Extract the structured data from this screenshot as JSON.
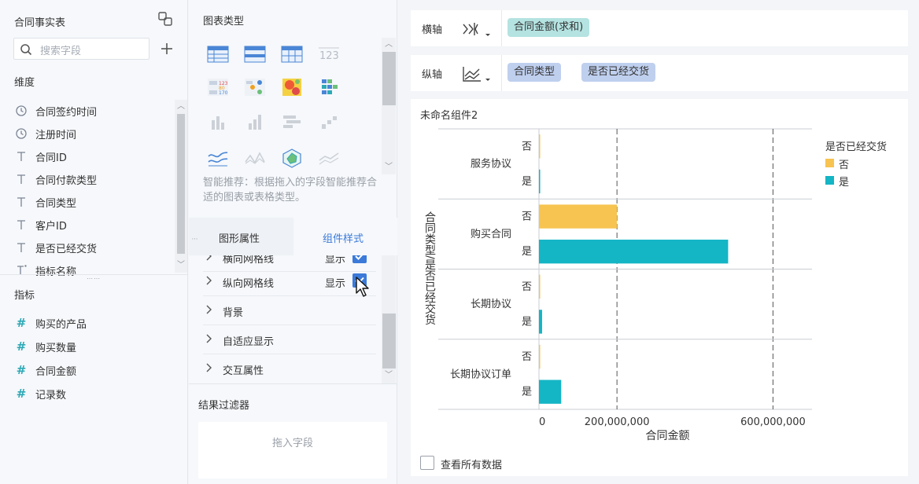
{
  "left_panel": {
    "title": "合同事实表",
    "search_placeholder": "搜索字段",
    "dimensions_label": "维度",
    "dimensions": [
      {
        "label": "合同签约时间",
        "icon": "clock-icon"
      },
      {
        "label": "注册时间",
        "icon": "clock-icon"
      },
      {
        "label": "合同ID",
        "icon": "text-type-icon"
      },
      {
        "label": "合同付款类型",
        "icon": "text-type-icon"
      },
      {
        "label": "合同类型",
        "icon": "text-type-icon"
      },
      {
        "label": "客户ID",
        "icon": "text-type-icon"
      },
      {
        "label": "是否已经交货",
        "icon": "text-type-icon"
      },
      {
        "label": "指标名称",
        "icon": "text-type-icon"
      }
    ],
    "measures_label": "指标",
    "measures": [
      {
        "label": "购买的产品",
        "icon": "number-icon"
      },
      {
        "label": "购买数量",
        "icon": "number-icon"
      },
      {
        "label": "合同金额",
        "icon": "number-icon"
      },
      {
        "label": "记录数",
        "icon": "number-icon"
      }
    ]
  },
  "middle_panel": {
    "chart_types_title": "图表类型",
    "hint": "智能推荐：根据拖入的字段智能推荐合适的图表或表格类型。",
    "tabs": {
      "shape_props": "图形属性",
      "component_style": "组件样式"
    },
    "props": [
      {
        "label": "横向网格线",
        "value": "显示",
        "checked": true
      },
      {
        "label": "纵向网格线",
        "value": "显示",
        "checked": true
      },
      {
        "label": "背景"
      },
      {
        "label": "自适应显示"
      },
      {
        "label": "交互属性"
      }
    ],
    "filter_title": "结果过滤器",
    "drop_placeholder": "拖入字段"
  },
  "axes": {
    "x_label": "横轴",
    "x_fields": [
      "合同金额(求和)"
    ],
    "y_label": "纵轴",
    "y_fields": [
      "合同类型",
      "是否已经交货"
    ]
  },
  "component": {
    "title": "未命名组件2",
    "view_all": "查看所有数据"
  },
  "colors": {
    "no": "#f7c451",
    "yes": "#14b5c5",
    "accent": "#3b7ad9"
  },
  "chart_data": {
    "type": "bar",
    "orientation": "horizontal",
    "categories": [
      "服务协议",
      "购买合同",
      "长期协议",
      "长期协议订单"
    ],
    "sub_labels": [
      "否",
      "是"
    ],
    "series": [
      {
        "name": "否",
        "values": [
          0,
          200000000,
          0,
          0
        ]
      },
      {
        "name": "是",
        "values": [
          3000000,
          485000000,
          8000000,
          57000000
        ]
      }
    ],
    "xlabel": "合同金额",
    "ylabel": "合同类型/是否已经交货",
    "x_ticks": [
      {
        "value": 0,
        "label": "0"
      },
      {
        "value": 200000000,
        "label": "200,000,000"
      },
      {
        "value": 600000000,
        "label": "600,000,000"
      }
    ],
    "xlim": [
      0,
      700000000
    ],
    "legend_title": "是否已经交货",
    "legend_position": "right",
    "grid": "vertical dashed at ticks"
  }
}
